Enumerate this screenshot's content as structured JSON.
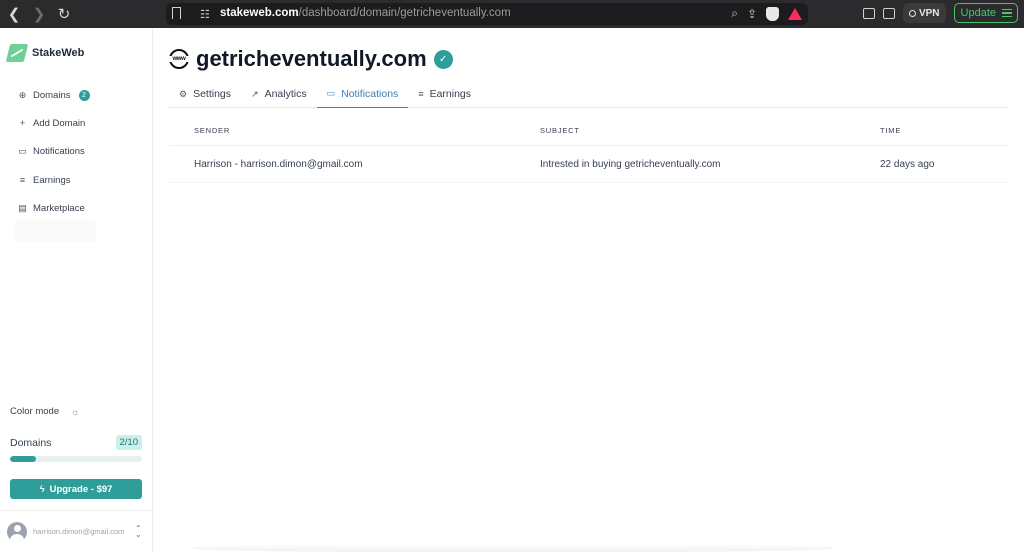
{
  "browser": {
    "url_host": "stakeweb.com",
    "url_path": "/dashboard/domain/getricheventually.com",
    "vpn_label": "VPN",
    "update_label": "Update"
  },
  "sidebar": {
    "brand": "StakeWeb",
    "items": [
      {
        "label": "Domains",
        "icon": "globe-icon",
        "badge": "2"
      },
      {
        "label": "Add Domain",
        "icon": "plus-icon"
      },
      {
        "label": "Notifications",
        "icon": "message-icon"
      },
      {
        "label": "Earnings",
        "icon": "money-icon"
      },
      {
        "label": "Marketplace",
        "icon": "store-icon"
      }
    ],
    "color_mode_label": "Color mode",
    "domains_label": "Domains",
    "domains_usage": "2/10",
    "domains_fraction": 0.2,
    "upgrade_label": "Upgrade - $97",
    "account_email": "harrison.dimon@gmail.com"
  },
  "main": {
    "title": "getricheventually.com",
    "tabs": [
      {
        "label": "Settings",
        "icon": "gear-icon"
      },
      {
        "label": "Analytics",
        "icon": "chart-icon"
      },
      {
        "label": "Notifications",
        "icon": "message-icon"
      },
      {
        "label": "Earnings",
        "icon": "money-icon"
      }
    ],
    "active_tab": "Notifications",
    "table": {
      "headers": [
        "SENDER",
        "SUBJECT",
        "TIME"
      ],
      "rows": [
        [
          "Harrison - harrison.dimon@gmail.com",
          "Intrested in buying getricheventually.com",
          "22 days ago"
        ]
      ]
    }
  },
  "colors": {
    "accent": "#2f9e9a",
    "active_tab": "#3d7fb8",
    "brand_logo": "#6fcf97"
  }
}
